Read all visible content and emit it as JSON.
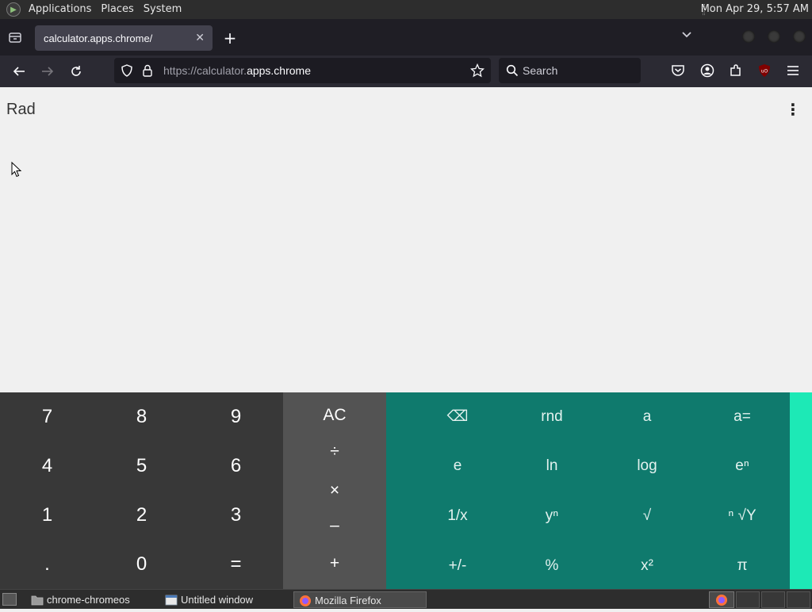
{
  "top_panel": {
    "menus": [
      "Applications",
      "Places",
      "System"
    ],
    "clock": "Mon Apr 29,  5:57 AM"
  },
  "browser": {
    "tab_title": "calculator.apps.chrome/",
    "url_prefix": "https://calculator.",
    "url_domain": "apps.chrome",
    "search_placeholder": "Search"
  },
  "calculator": {
    "mode": "Rad",
    "numpad": [
      [
        "7",
        "8",
        "9"
      ],
      [
        "4",
        "5",
        "6"
      ],
      [
        "1",
        "2",
        "3"
      ],
      [
        ".",
        "0",
        "="
      ]
    ],
    "operators": [
      "AC",
      "÷",
      "×",
      "–",
      "+"
    ],
    "advanced": [
      [
        "⌫",
        "rnd",
        "a",
        "a="
      ],
      [
        "e",
        "ln",
        "log",
        "eⁿ"
      ],
      [
        "1/x",
        "yⁿ",
        "√",
        "ⁿ √Y"
      ],
      [
        "+/-",
        "%",
        "x²",
        "π"
      ]
    ]
  },
  "taskbar": {
    "items": [
      "chrome-chromeos",
      "Untitled window",
      "Mozilla Firefox"
    ]
  },
  "colors": {
    "numpad_bg": "#383838",
    "operator_bg": "#535353",
    "advanced_bg": "#0f7a6d",
    "advanced_edge": "#1de9b6"
  }
}
